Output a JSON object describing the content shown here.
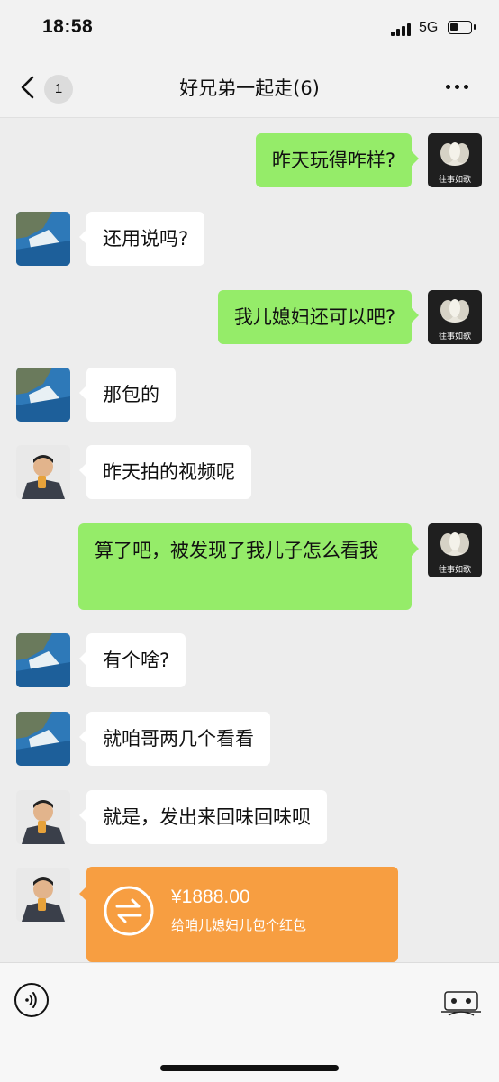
{
  "status": {
    "time": "18:58",
    "network": "5G"
  },
  "nav": {
    "unread": "1",
    "title": "好兄弟一起走(6)"
  },
  "avatars": {
    "self_caption": "往事如歌"
  },
  "messages": [
    {
      "from": "self",
      "text": "昨天玩得咋样?"
    },
    {
      "from": "sea",
      "text": "还用说吗?"
    },
    {
      "from": "self",
      "text": "我儿媳妇还可以吧?"
    },
    {
      "from": "sea",
      "text": "那包的"
    },
    {
      "from": "man",
      "text": "昨天拍的视频呢"
    },
    {
      "from": "self",
      "text": "算了吧，被发现了我儿子怎么看我"
    },
    {
      "from": "sea",
      "text": "有个啥?"
    },
    {
      "from": "sea",
      "text": "就咱哥两几个看看"
    },
    {
      "from": "man",
      "text": "就是，发出来回味回味呗"
    }
  ],
  "red_packet": {
    "amount": "¥1888.00",
    "note": "给咱儿媳妇儿包个红包"
  },
  "colors": {
    "outgoing": "#95ec69",
    "incoming": "#ffffff",
    "red_packet": "#f79e41",
    "background": "#ededed"
  }
}
